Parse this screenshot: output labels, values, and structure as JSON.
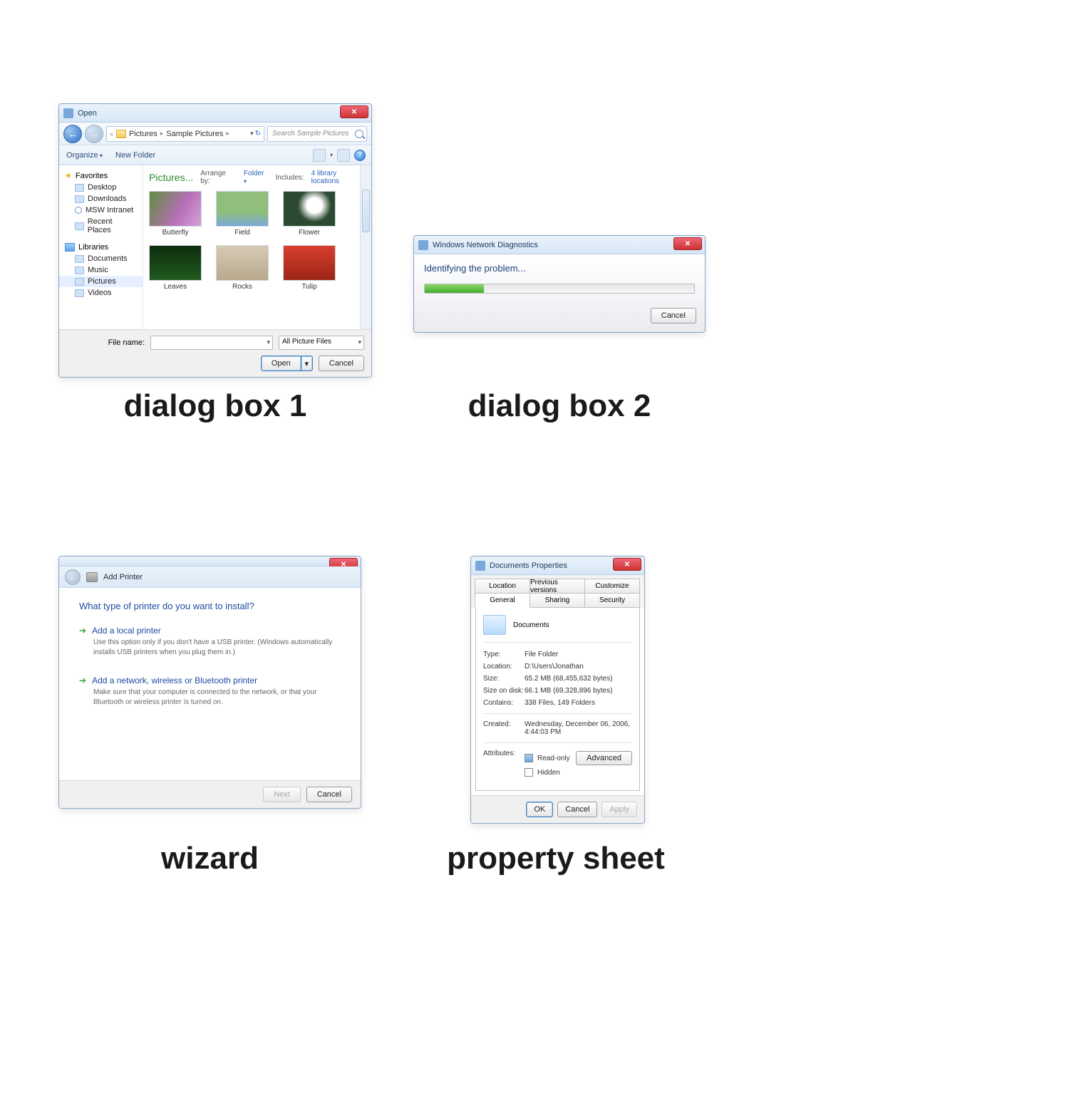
{
  "captions": {
    "d1": "dialog box 1",
    "d2": "dialog box 2",
    "d3": "wizard",
    "d4": "property sheet"
  },
  "d1": {
    "title": "Open",
    "breadcrumb": {
      "pre": "«",
      "a": "Pictures",
      "b": "Sample Pictures"
    },
    "search_placeholder": "Search Sample Pictures",
    "toolbar": {
      "organize": "Organize",
      "newfolder": "New Folder"
    },
    "side": {
      "favorites": "Favorites",
      "favitems": [
        "Desktop",
        "Downloads",
        "MSW Intranet",
        "Recent Places"
      ],
      "libraries": "Libraries",
      "libitems": [
        "Documents",
        "Music",
        "Pictures",
        "Videos"
      ]
    },
    "header": {
      "title": "Pictures...",
      "arrange_lbl": "Arrange by:",
      "arrange_val": "Folder",
      "includes_lbl": "Includes:",
      "includes_val": "4 library locations"
    },
    "thumbs": [
      "Butterfly",
      "Field",
      "Flower",
      "Leaves",
      "Rocks",
      "Tulip"
    ],
    "foot": {
      "filename_lbl": "File name:",
      "filter": "All Picture Files",
      "open": "Open",
      "cancel": "Cancel"
    }
  },
  "d2": {
    "title": "Windows Network Diagnostics",
    "msg": "Identifying the problem...",
    "cancel": "Cancel"
  },
  "d3": {
    "title": "Add Printer",
    "question": "What type of printer do you want to install?",
    "opt1": {
      "title": "Add a local printer",
      "desc": "Use this option only if you don't have a USB printer. (Windows automatically installs USB printers when you plug them in.)"
    },
    "opt2": {
      "title": "Add a network, wireless or Bluetooth printer",
      "desc": "Make sure that your computer is connected to the network, or that your Bluetooth or wireless printer is turned on."
    },
    "next": "Next",
    "cancel": "Cancel"
  },
  "d4": {
    "title": "Documents Properties",
    "tabs": [
      "Location",
      "Previous versions",
      "Customize",
      "General",
      "Sharing",
      "Security"
    ],
    "name": "Documents",
    "rows": {
      "type_k": "Type:",
      "type_v": "File Folder",
      "loc_k": "Location:",
      "loc_v": "D:\\Users\\Jonathan",
      "size_k": "Size:",
      "size_v": "65.2 MB (68,455,632 bytes)",
      "sod_k": "Size on disk:",
      "sod_v": "66.1 MB (69,328,896 bytes)",
      "cont_k": "Contains:",
      "cont_v": "338 Files, 149 Folders",
      "created_k": "Created:",
      "created_v": "Wednesday, December 06, 2006, 4:44:03 PM",
      "attr_k": "Attributes:",
      "readonly": "Read-only",
      "hidden": "Hidden",
      "advanced": "Advanced"
    },
    "ok": "OK",
    "cancel": "Cancel",
    "apply": "Apply"
  }
}
